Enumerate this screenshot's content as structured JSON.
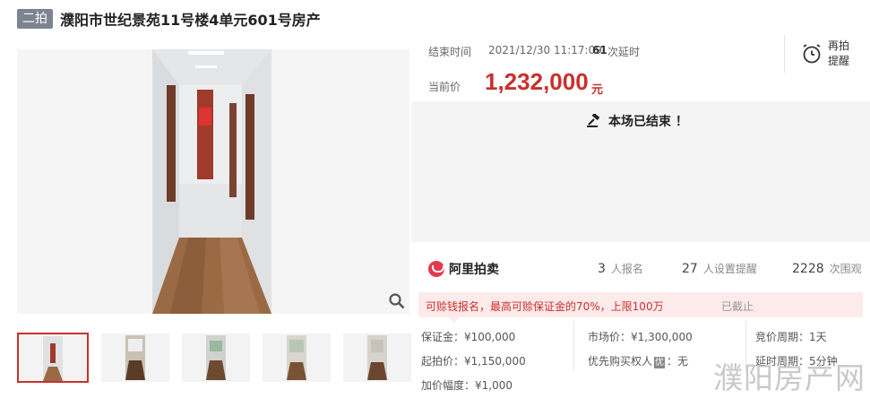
{
  "header": {
    "badge": "二拍",
    "title": "濮阳市世纪景苑11号楼4单元601号房产"
  },
  "auction": {
    "end_label": "结束时间",
    "end_time": "2021/12/30 11:17:09",
    "delay_count": "61",
    "delay_label": "次延时",
    "price_label": "当前价",
    "current_price": "1,232,000",
    "price_unit": "元",
    "remind_label": "再拍提醒",
    "status_message": "本场已结束 ！"
  },
  "platform": {
    "logo_text": "阿里拍卖",
    "signups": "3",
    "signups_label": "人报名",
    "reminders": "27",
    "reminders_label": "人设置提醒",
    "views": "2228",
    "views_label": "次围观"
  },
  "notice": {
    "text": "可赊钱报名，最高可赊保证金的70%，上限100万",
    "status": "已截止"
  },
  "details": {
    "deposit": "保证金：¥100,000",
    "market_price": "市场价：¥1,300,000",
    "bid_period": "竞价周期：1天",
    "start_price": "起拍价：¥1,150,000",
    "priority_prefix": "优先购买权人",
    "priority_tag": "优",
    "priority_value": "：无",
    "delay_period": "延时周期：5分钟",
    "increment": "加价幅度：¥1,000"
  },
  "watermark": "濮阳房产网",
  "colors": {
    "accent": "#c8302d",
    "badge_bg": "#7c8491",
    "notice_bg": "#fdeaea"
  }
}
